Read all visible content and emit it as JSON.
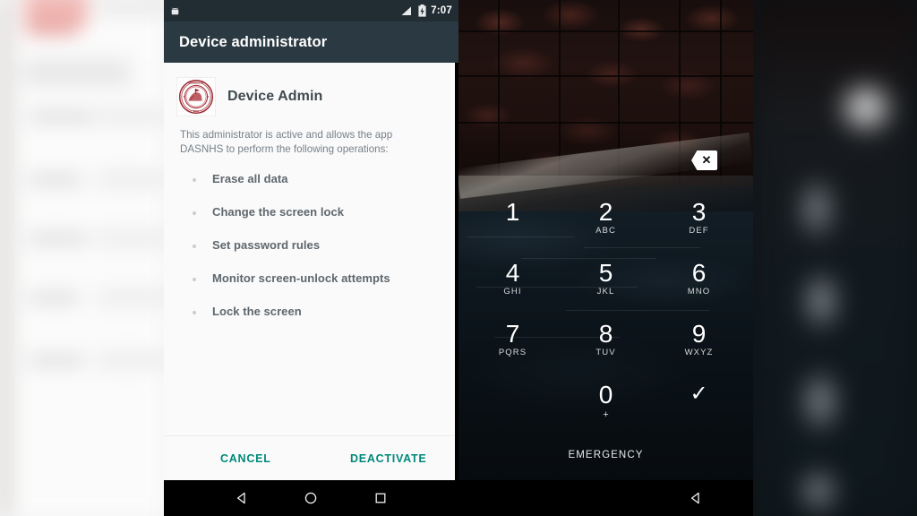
{
  "statusbar": {
    "notification_icon": "android-robot-icon",
    "signal_icon": "signal-bars-icon",
    "battery_icon": "battery-charging-icon",
    "time": "7:07"
  },
  "toolbar": {
    "title": "Device administrator"
  },
  "dialog": {
    "app_icon": "device-admin-seal-icon",
    "app_name": "Device Admin",
    "description": "This administrator is active and allows the app DASNHS to perform the following operations:",
    "operations": [
      {
        "label": "Erase all data"
      },
      {
        "label": "Change the screen lock"
      },
      {
        "label": "Set password rules"
      },
      {
        "label": "Monitor screen-unlock attempts"
      },
      {
        "label": "Lock the screen"
      }
    ],
    "cancel_label": "CANCEL",
    "deactivate_label": "DEACTIVATE",
    "accent_color": "#00897b",
    "header_color": "#2b3a42",
    "body_color": "#fafafa"
  },
  "lockscreen": {
    "backspace_icon": "backspace-key-icon",
    "keys": [
      {
        "num": "1",
        "sub": ""
      },
      {
        "num": "2",
        "sub": "ABC"
      },
      {
        "num": "3",
        "sub": "DEF"
      },
      {
        "num": "4",
        "sub": "GHI"
      },
      {
        "num": "5",
        "sub": "JKL"
      },
      {
        "num": "6",
        "sub": "MNO"
      },
      {
        "num": "7",
        "sub": "PQRS"
      },
      {
        "num": "8",
        "sub": "TUV"
      },
      {
        "num": "9",
        "sub": "WXYZ"
      },
      {
        "num": "0",
        "sub": "+"
      }
    ],
    "confirm_icon": "checkmark-icon",
    "confirm_glyph": "✓",
    "emergency_label": "EMERGENCY"
  },
  "navbar": {
    "back_icon": "back-triangle-icon",
    "home_icon": "home-circle-icon",
    "recents_icon": "recents-square-icon",
    "back_icon_right": "back-triangle-icon"
  }
}
